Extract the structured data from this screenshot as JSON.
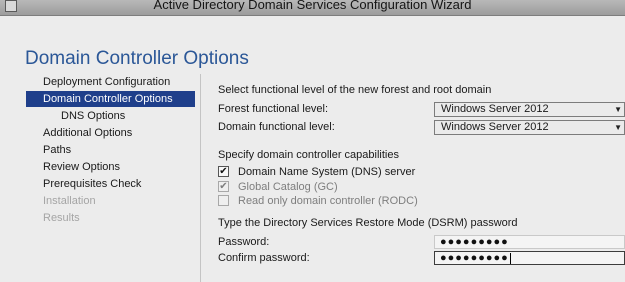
{
  "window": {
    "title": "Active Directory Domain Services Configuration Wizard",
    "page_title": "Domain Controller Options"
  },
  "nav": {
    "items": [
      {
        "label": "Deployment Configuration",
        "state": "normal"
      },
      {
        "label": "Domain Controller Options",
        "state": "active"
      },
      {
        "label": "DNS Options",
        "state": "sub"
      },
      {
        "label": "Additional Options",
        "state": "normal"
      },
      {
        "label": "Paths",
        "state": "normal"
      },
      {
        "label": "Review Options",
        "state": "normal"
      },
      {
        "label": "Prerequisites Check",
        "state": "normal"
      },
      {
        "label": "Installation",
        "state": "disabled"
      },
      {
        "label": "Results",
        "state": "disabled"
      }
    ]
  },
  "functional_level": {
    "heading": "Select functional level of the new forest and root domain",
    "forest_label": "Forest functional level:",
    "forest_value": "Windows Server 2012",
    "domain_label": "Domain functional level:",
    "domain_value": "Windows Server 2012"
  },
  "capabilities": {
    "heading": "Specify domain controller capabilities",
    "dns_label": "Domain Name System (DNS) server",
    "dns_checked": true,
    "gc_label": "Global Catalog (GC)",
    "gc_checked": true,
    "rodc_label": "Read only domain controller (RODC)",
    "rodc_checked": false
  },
  "dsrm": {
    "heading": "Type the Directory Services Restore Mode (DSRM) password",
    "password_label": "Password:",
    "password_value": "●●●●●●●●●",
    "confirm_label": "Confirm password:",
    "confirm_value": "●●●●●●●●●"
  },
  "glyphs": {
    "check": "✔",
    "dropdown": "▼"
  }
}
